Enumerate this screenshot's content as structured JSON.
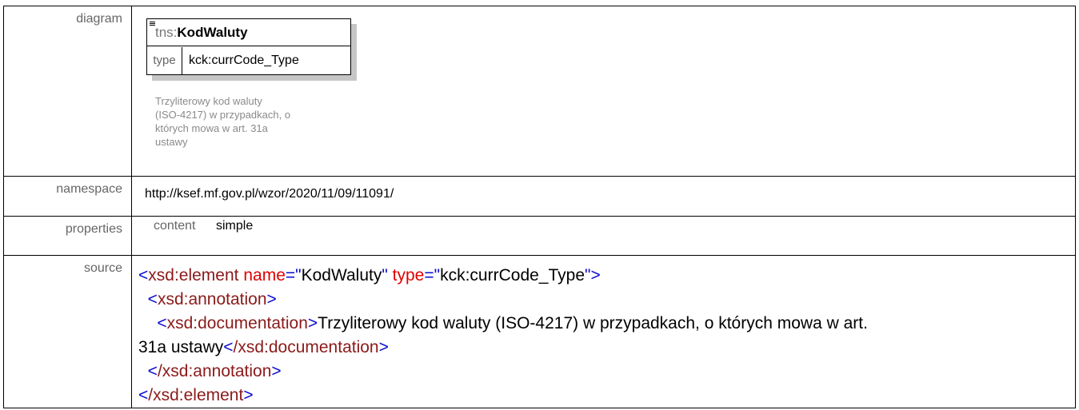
{
  "rows": {
    "diagram_label": "diagram",
    "namespace_label": "namespace",
    "properties_label": "properties",
    "source_label": "source"
  },
  "diagram": {
    "prefix": "tns:",
    "name": "KodWaluty",
    "type_key": "type",
    "type_value": "kck:currCode_Type",
    "note_lines": [
      "Trzyliterowy kod waluty",
      "(ISO-4217) w przypadkach, o",
      "których mowa w art. 31a",
      "ustawy"
    ]
  },
  "namespace": "http://ksef.mf.gov.pl/wzor/2020/11/09/11091/",
  "properties": {
    "key": "content",
    "value": "simple"
  },
  "source": {
    "l1_tag": "xsd:element",
    "l1_attr1_name": "name",
    "l1_attr1_value": "KodWaluty",
    "l1_attr2_name": "type",
    "l1_attr2_value": "kck:currCode_Type",
    "l2_tag": "xsd:annotation",
    "l3_tag": "xsd:documentation",
    "l3_text": "Trzyliterowy kod waluty (ISO-4217) w przypadkach, o których mowa w art.",
    "l4_text": "31a ustawy",
    "l4_close_tag": "/xsd:documentation",
    "l5_close_tag": "/xsd:annotation",
    "l6_close_tag": "/xsd:element"
  }
}
